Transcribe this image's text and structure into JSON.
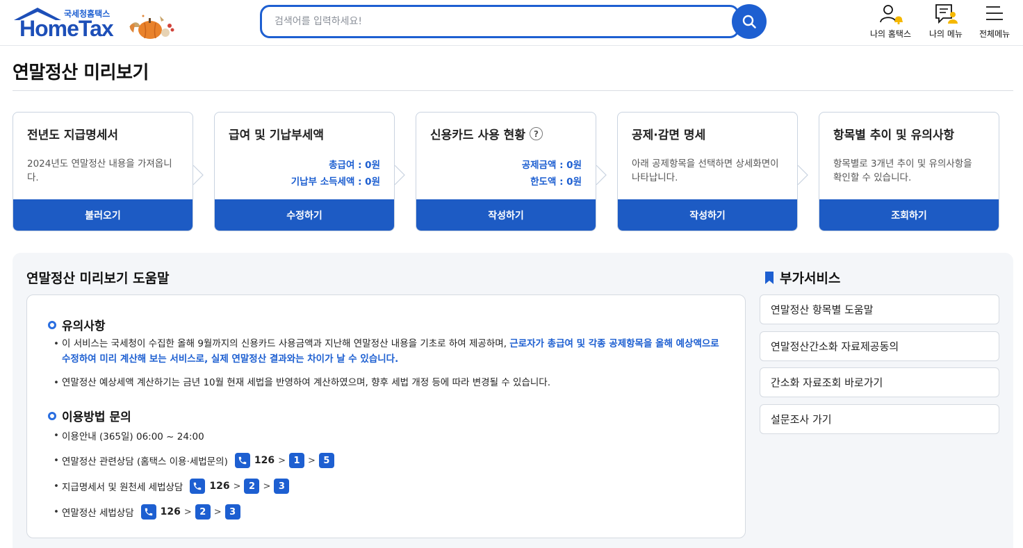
{
  "header": {
    "logo_sub": "국세청홈택스",
    "logo_main": "HomeTax",
    "search_placeholder": "검색어를 입력하세요!",
    "menus": [
      {
        "label": "나의 홈택스",
        "icon": "user-bell-icon"
      },
      {
        "label": "나의 메뉴",
        "icon": "doc-user-icon"
      },
      {
        "label": "전체메뉴",
        "icon": "hamburger-icon"
      }
    ]
  },
  "page": {
    "title": "연말정산 미리보기"
  },
  "steps": [
    {
      "title": "전년도 지급명세서",
      "desc": "2024년도 연말정산 내용을 가져옵니다.",
      "button": "불러오기"
    },
    {
      "title": "급여 및 기납부세액",
      "values": [
        "총급여 : 0원",
        "기납부 소득세액 : 0원"
      ],
      "button": "수정하기"
    },
    {
      "title": "신용카드 사용 현황",
      "help": "?",
      "values": [
        "공제금액 : 0원",
        "한도액 : 0원"
      ],
      "button": "작성하기"
    },
    {
      "title": "공제·감면 명세",
      "desc": "아래 공제항목을 선택하면 상세화면이 나타납니다.",
      "button": "작성하기"
    },
    {
      "title": "항목별 추이 및 유의사항",
      "desc": "항목별로 3개년 추이 및 유의사항을 확인할 수 있습니다.",
      "button": "조회하기"
    }
  ],
  "help": {
    "title": "연말정산 미리보기 도움말",
    "notes_heading": "유의사항",
    "note1_plain": "이 서비스는 국세청이 수집한 올해 9월까지의 신용카드 사용금액과 지난해 연말정산 내용을 기초로 하여 제공하며, ",
    "note1_highlight": "근로자가 총급여 및 각종 공제항목을 올해 예상액으로 수정하여 미리 계산해 보는 서비스로, 실제 연말정산 결과와는 차이가 날 수 있습니다.",
    "note2": "연말정산 예상세액 계산하기는 금년 10월 현재 세법을 반영하여 계산하였으며, 향후 세법 개정 등에 따라 변경될 수 있습니다.",
    "usage_heading": "이용방법 문의",
    "hours": "이용안내 (365일) 06:00 ~ 24:00",
    "contacts": [
      {
        "label": "연말정산 관련상담 (홈택스 이용·세법문의)",
        "phone": "126",
        "steps": [
          "1",
          "5"
        ]
      },
      {
        "label": "지급명세서 및 원천세 세법상담",
        "phone": "126",
        "steps": [
          "2",
          "3"
        ]
      },
      {
        "label": "연말정산 세법상담",
        "phone": "126",
        "steps": [
          "2",
          "3"
        ]
      }
    ]
  },
  "side": {
    "title": "부가서비스",
    "items": [
      "연말정산 항목별 도움말",
      "연말정산간소화 자료제공동의",
      "간소화 자료조회 바로가기",
      "설문조사 가기"
    ]
  },
  "colors": {
    "primary": "#1d5fd1",
    "button": "#1d5bc4",
    "panel_bg": "#f4f6f9"
  }
}
